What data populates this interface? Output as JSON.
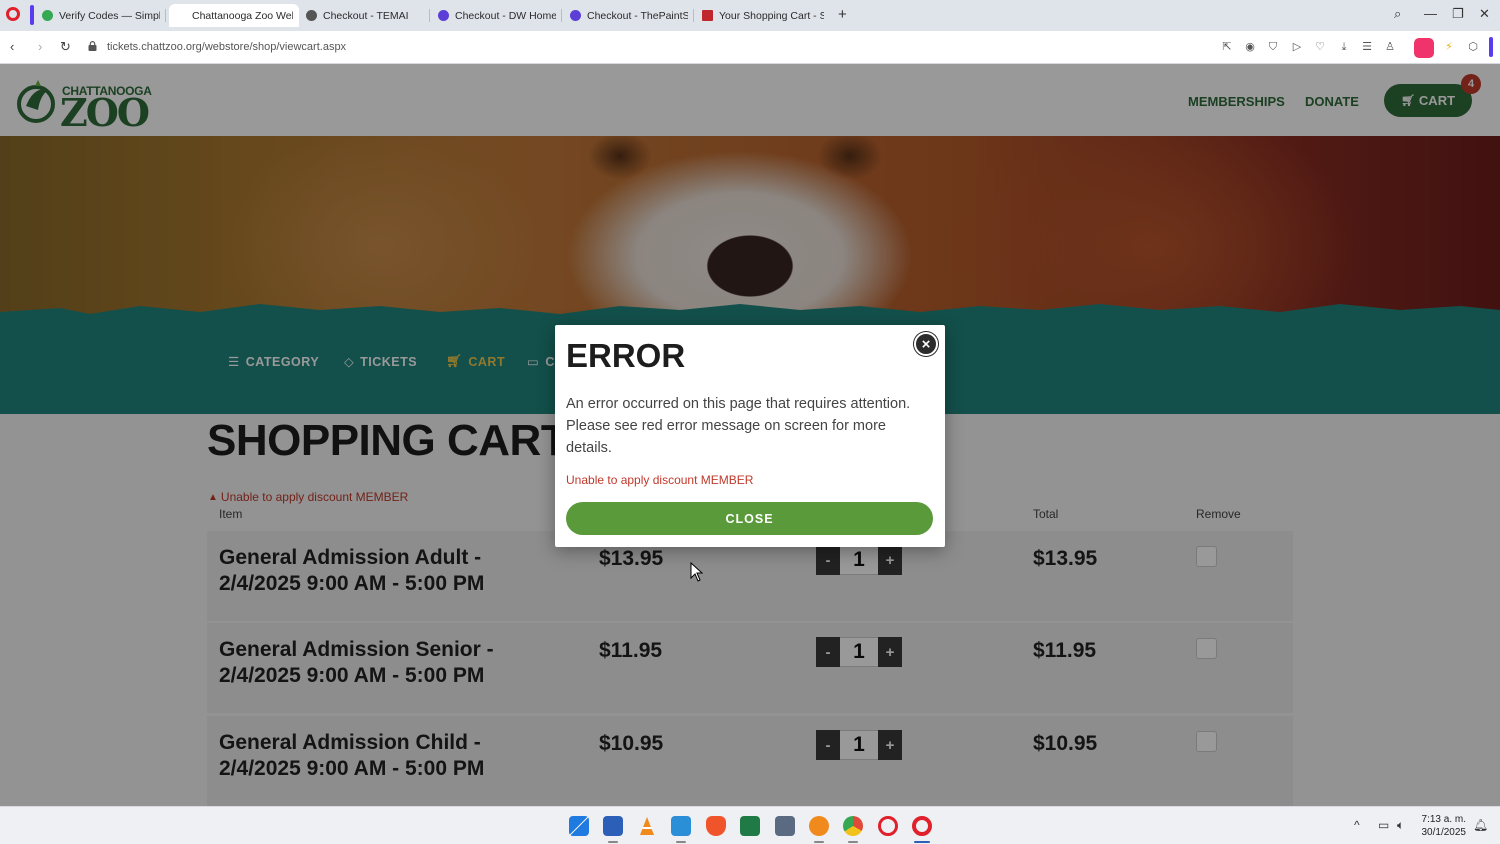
{
  "browser": {
    "tabs": [
      {
        "label": "Verify Codes — SimplyCodes",
        "color": "#34a853"
      },
      {
        "label": "Chattanooga Zoo Web Store",
        "color": "#ffffff"
      },
      {
        "label": "Checkout - TEMAI",
        "color": "#555555"
      },
      {
        "label": "Checkout - DW Home Candles",
        "color": "#5b3fd6"
      },
      {
        "label": "Checkout - ThePaintStore",
        "color": "#5b3fd6"
      },
      {
        "label": "Your Shopping Cart - Scalp",
        "color": "#c0262d"
      }
    ],
    "new_tab_label": "+",
    "url": "tickets.chattzoo.org/webstore/shop/viewcart.aspx"
  },
  "header": {
    "logo_top": "CHATTANOOGA",
    "logo_main": "ZOO",
    "nav": [
      "MEMBERSHIPS",
      "DONATE"
    ],
    "cart_label": "CART",
    "cart_count": "4"
  },
  "category_nav": [
    {
      "label": "CATEGORY",
      "icon": "menu-icon"
    },
    {
      "label": "TICKETS",
      "icon": "ticket-icon"
    },
    {
      "label": "CART",
      "icon": "cart-icon"
    },
    {
      "label": "C",
      "icon": "card-icon"
    }
  ],
  "cart": {
    "title": "SHOPPING CART",
    "discount_error": "Unable to apply discount MEMBER",
    "columns": {
      "item": "Item",
      "total": "Total",
      "remove": "Remove"
    },
    "items": [
      {
        "name_line1": "General Admission Adult  -",
        "name_line2": "2/4/2025 9:00 AM - 5:00 PM",
        "price": "$13.95",
        "qty": "1",
        "total": "$13.95"
      },
      {
        "name_line1": "General Admission Senior  -",
        "name_line2": "2/4/2025 9:00 AM - 5:00 PM",
        "price": "$11.95",
        "qty": "1",
        "total": "$11.95"
      },
      {
        "name_line1": "General Admission Child  -",
        "name_line2": "2/4/2025 9:00 AM - 5:00 PM",
        "price": "$10.95",
        "qty": "1",
        "total": "$10.95"
      }
    ],
    "minus_label": "-",
    "plus_label": "+"
  },
  "modal": {
    "title": "ERROR",
    "close_icon": "×",
    "body": "An error occurred on this page that requires attention. Please see red error message on screen for more details.",
    "error": "Unable to apply discount MEMBER",
    "button_label": "CLOSE"
  },
  "taskbar": {
    "time": "7:13 a. m.",
    "date": "30/1/2025",
    "apps": [
      {
        "name": "windows-start-icon",
        "color": "#1f7be0"
      },
      {
        "name": "word-icon",
        "color": "#2b5fb8"
      },
      {
        "name": "vlc-icon",
        "color": "#f08a1c"
      },
      {
        "name": "notepad-icon",
        "color": "#2a8fd6"
      },
      {
        "name": "brave-icon",
        "color": "#f0542a"
      },
      {
        "name": "excel-icon",
        "color": "#1f7a45"
      },
      {
        "name": "calculator-icon",
        "color": "#5a6a80"
      },
      {
        "name": "ccleaner-icon",
        "color": "#f08a1c"
      },
      {
        "name": "chrome-icon",
        "color": "#34a853"
      },
      {
        "name": "opera-gx-icon",
        "color": "#e0202a"
      },
      {
        "name": "opera-icon",
        "color": "#e0202a"
      }
    ]
  }
}
